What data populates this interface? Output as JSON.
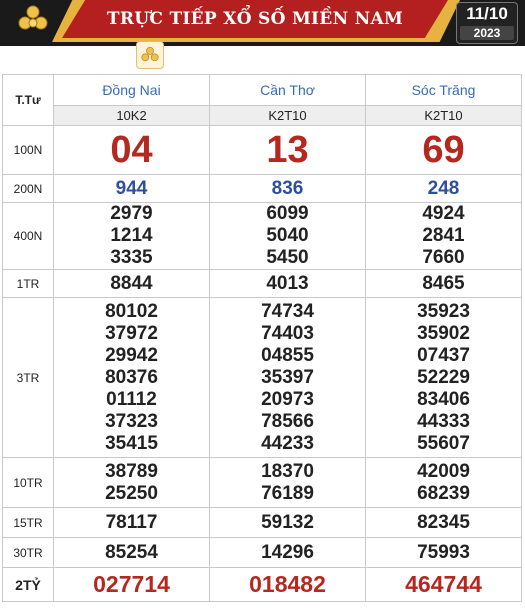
{
  "header": {
    "title": "TRỰC TIẾP XỔ SỐ MIỀN NAM",
    "date_day": "11/10",
    "date_year": "2023",
    "logo_icon": "lottery-balls-icon",
    "colors": {
      "dark": "#1a1a1a",
      "red": "#b3201f",
      "gold": "#e7b340"
    }
  },
  "table": {
    "label_header": "T.Tư",
    "provinces": [
      "Đồng Nai",
      "Cần Thơ",
      "Sóc Trăng"
    ],
    "codes": [
      "10K2",
      "K2T10",
      "K2T10"
    ],
    "rows": [
      {
        "label": "100N",
        "values": [
          [
            "04"
          ],
          [
            "13"
          ],
          [
            "69"
          ]
        ]
      },
      {
        "label": "200N",
        "values": [
          [
            "944"
          ],
          [
            "836"
          ],
          [
            "248"
          ]
        ]
      },
      {
        "label": "400N",
        "values": [
          [
            "2979",
            "1214",
            "3335"
          ],
          [
            "6099",
            "5040",
            "5450"
          ],
          [
            "4924",
            "2841",
            "7660"
          ]
        ]
      },
      {
        "label": "1TR",
        "values": [
          [
            "8844"
          ],
          [
            "4013"
          ],
          [
            "8465"
          ]
        ]
      },
      {
        "label": "3TR",
        "values": [
          [
            "80102",
            "37972",
            "29942",
            "80376",
            "01112",
            "37323",
            "35415"
          ],
          [
            "74734",
            "74403",
            "04855",
            "35397",
            "20973",
            "78566",
            "44233"
          ],
          [
            "35923",
            "35902",
            "07437",
            "52229",
            "83406",
            "44333",
            "55607"
          ]
        ]
      },
      {
        "label": "10TR",
        "values": [
          [
            "38789",
            "25250"
          ],
          [
            "18370",
            "76189"
          ],
          [
            "42009",
            "68239"
          ]
        ]
      },
      {
        "label": "15TR",
        "values": [
          [
            "78117"
          ],
          [
            "59132"
          ],
          [
            "82345"
          ]
        ]
      },
      {
        "label": "30TR",
        "values": [
          [
            "85254"
          ],
          [
            "14296"
          ],
          [
            "75993"
          ]
        ]
      },
      {
        "label": "2TỶ",
        "values": [
          [
            "027714"
          ],
          [
            "018482"
          ],
          [
            "464744"
          ]
        ]
      }
    ]
  }
}
